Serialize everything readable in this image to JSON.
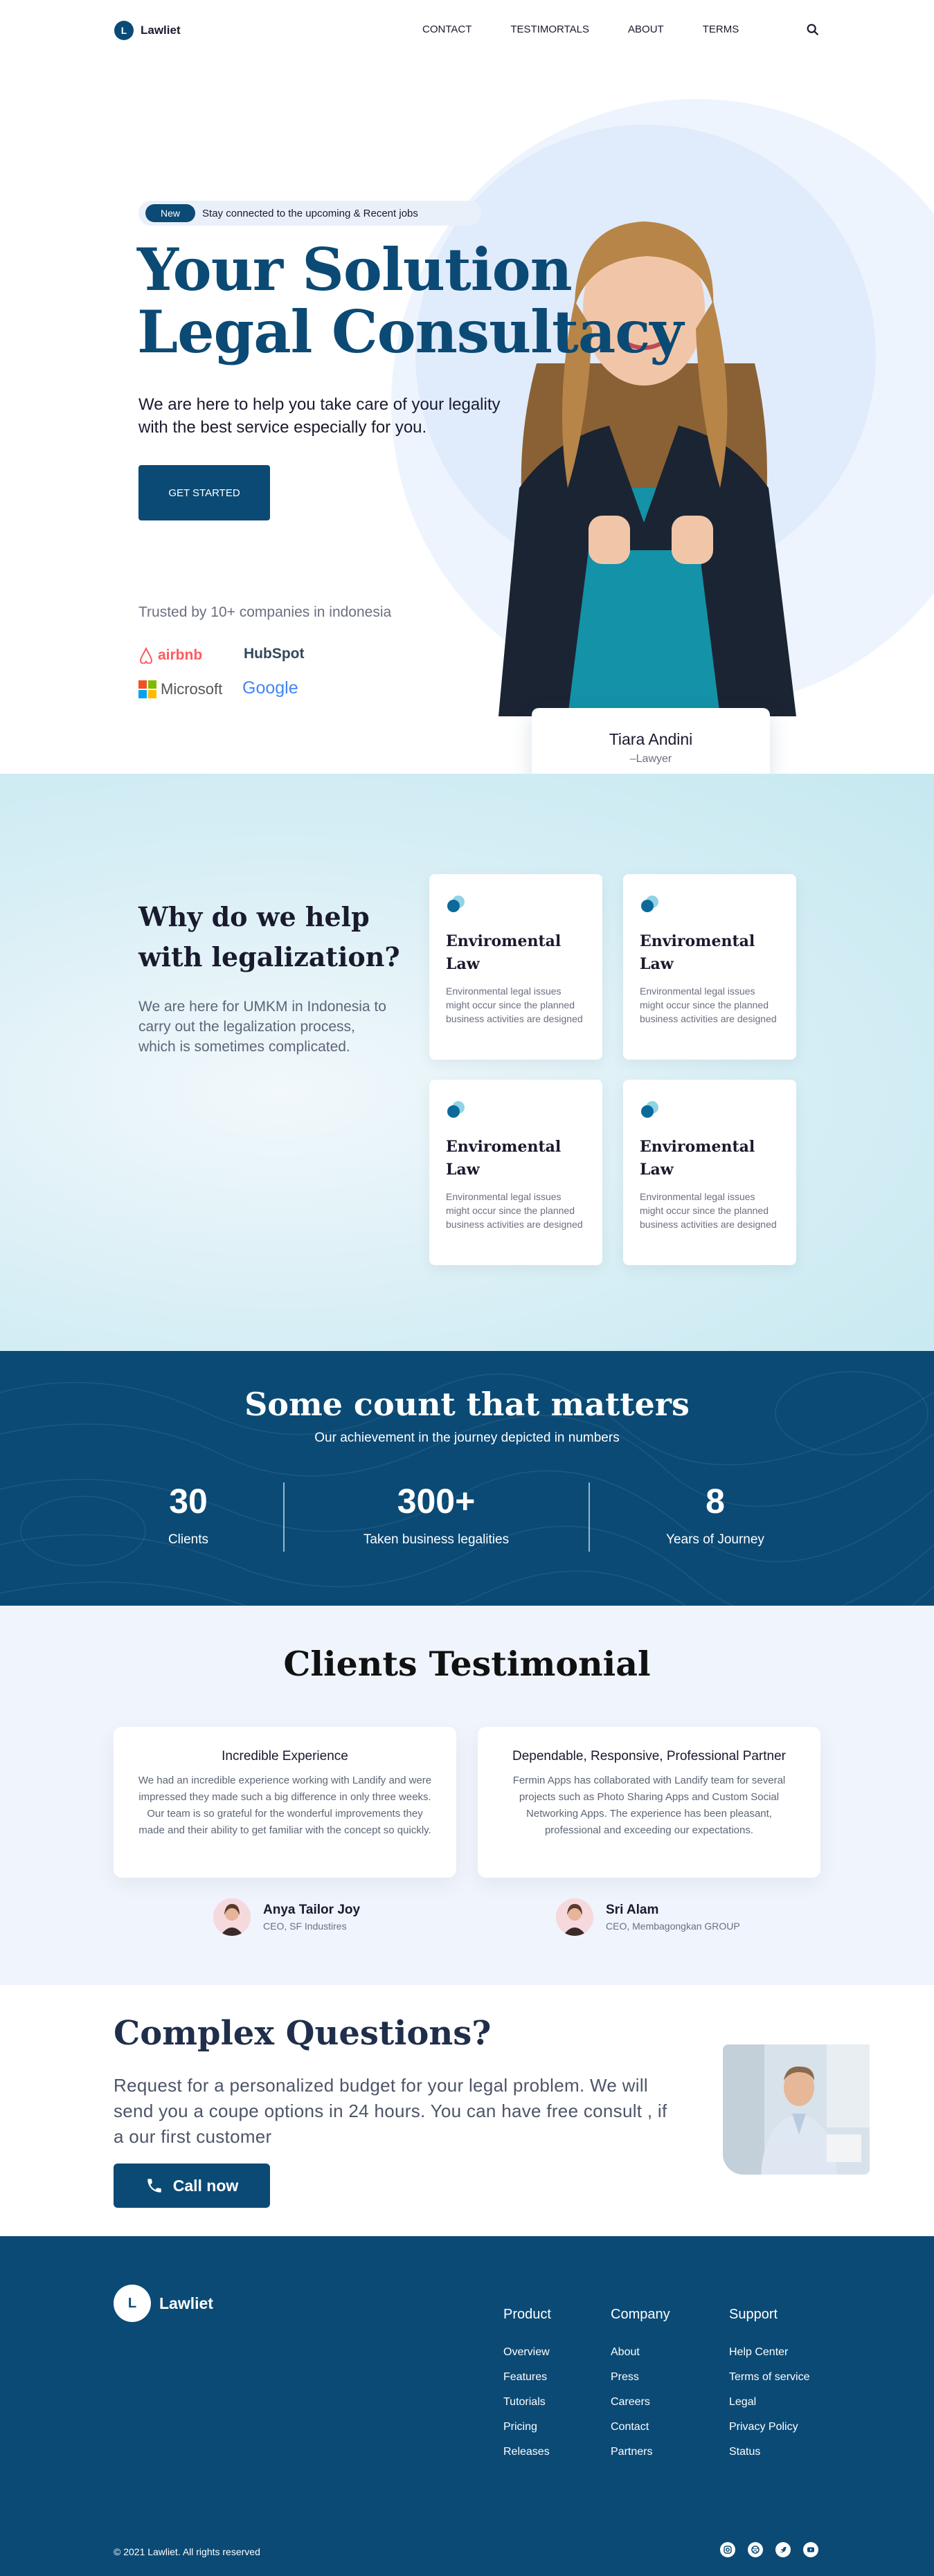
{
  "nav": {
    "logo_letter": "L",
    "brand": "Lawliet",
    "links": [
      "CONTACT",
      "TESTIMORTALS",
      "ABOUT",
      "TERMS"
    ]
  },
  "hero": {
    "badge_label": "New",
    "badge_text": "Stay connected to the upcoming & Recent jobs",
    "title_line1": "Your Solution",
    "title_line2": "Legal Consultacy",
    "subtitle": "We are here to help you take care of your legality with the best service especially for you.",
    "cta": "GET STARTED",
    "trusted": "Trusted by 10+ companies in indonesia",
    "brands": [
      "airbnb",
      "HubSpot",
      "Microsoft",
      "Google"
    ],
    "person_name": "Tiara Andini",
    "person_role": "–Lawyer"
  },
  "why": {
    "title_line1": "Why do we help",
    "title_line2": "with legalization?",
    "text": "We are here for UMKM in Indonesia to carry out the legalization process, which is sometimes complicated.",
    "cards": [
      {
        "title_line1": "Enviromental",
        "title_line2": "Law",
        "text": "Environmental legal issues might occur since the planned business activities are designed"
      },
      {
        "title_line1": "Enviromental",
        "title_line2": "Law",
        "text": "Environmental legal issues might occur since the planned business activities are designed"
      },
      {
        "title_line1": "Enviromental",
        "title_line2": "Law",
        "text": "Environmental legal issues might occur since the planned business activities are designed"
      },
      {
        "title_line1": "Enviromental",
        "title_line2": "Law",
        "text": "Environmental legal issues might occur since the planned business activities are designed"
      }
    ]
  },
  "stats": {
    "title": "Some count that matters",
    "subtitle": "Our achievement in the journey depicted in numbers",
    "items": [
      {
        "value": "30",
        "label": "Clients"
      },
      {
        "value": "300+",
        "label": "Taken business legalities"
      },
      {
        "value": "8",
        "label": "Years of Journey"
      }
    ]
  },
  "testimonials": {
    "title": "Clients Testimonial",
    "items": [
      {
        "heading": "Incredible Experience",
        "body": "We had an incredible experience working with Landify and were impressed they made such a big difference in only three weeks. Our team is so grateful for the wonderful improvements they made and their ability to get familiar with the concept so quickly.",
        "name": "Anya Tailor Joy",
        "role": "CEO, SF Industires"
      },
      {
        "heading": "Dependable, Responsive, Professional Partner",
        "body": "Fermin Apps has collaborated with Landify team for several projects such as Photo Sharing Apps and Custom Social Networking Apps. The experience has been pleasant, professional and exceeding our expectations.",
        "name": "Sri Alam",
        "role": "CEO, Membagongkan GROUP"
      }
    ]
  },
  "cta": {
    "title": "Complex Questions?",
    "text": "Request for a personalized budget for your legal problem. We will send you a coupe options in 24 hours. You can have free consult , if a our first customer",
    "button": "Call now"
  },
  "footer": {
    "logo_letter": "L",
    "brand": "Lawliet",
    "columns": [
      {
        "title": "Product",
        "links": [
          "Overview",
          "Features",
          "Tutorials",
          "Pricing",
          "Releases"
        ]
      },
      {
        "title": "Company",
        "links": [
          "About",
          "Press",
          "Careers",
          "Contact",
          "Partners"
        ]
      },
      {
        "title": "Support",
        "links": [
          "Help Center",
          "Terms of service",
          "Legal",
          "Privacy Policy",
          "Status"
        ]
      }
    ],
    "copyright": "© 2021 Lawliet. All rights reserved",
    "socials": [
      "instagram-icon",
      "dribbble-icon",
      "twitter-icon",
      "youtube-icon"
    ]
  },
  "colors": {
    "primary": "#0b4a75",
    "light_blue": "#e0ebfb",
    "teal": "#1a8fb0"
  }
}
